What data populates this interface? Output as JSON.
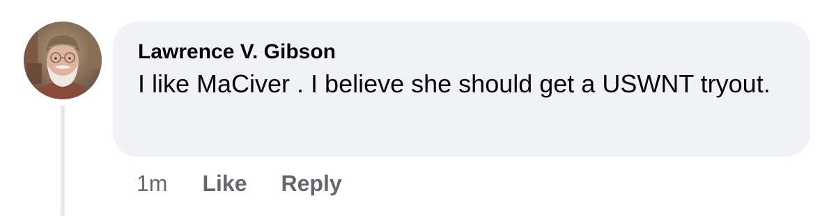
{
  "comment": {
    "author": "Lawrence V. Gibson",
    "text": "I like MaCiver . I believe she should get a USWNT tryout.",
    "timestamp": "1m",
    "like_label": "Like",
    "reply_label": "Reply"
  },
  "colors": {
    "bubble_bg": "#f0f2f5",
    "text": "#050505",
    "secondary_text": "#65676b",
    "thread_line": "#e4e6eb"
  },
  "icons": {
    "avatar": "user-profile-photo"
  }
}
